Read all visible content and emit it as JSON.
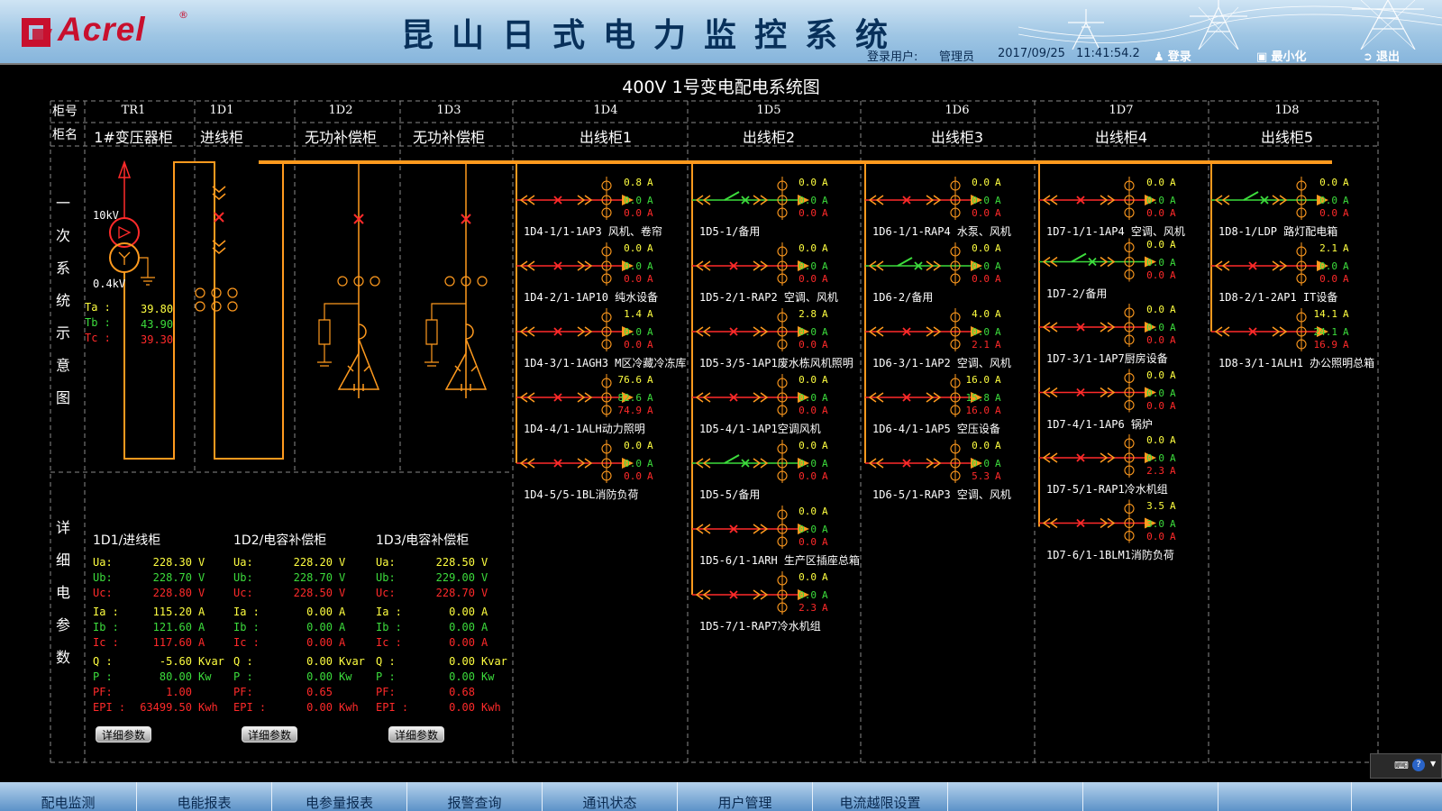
{
  "header": {
    "logo": "Acrel",
    "logo_mark": "®",
    "title": "昆山日式电力监控系统",
    "login_user_label": "登录用户:",
    "user_name": "管理员",
    "date": "2017/09/25",
    "time": "11:41:54.2",
    "login_btn": "登录",
    "minimize_btn": "最小化",
    "exit_btn": "退出"
  },
  "diagram": {
    "title": "400V 1号变电配电系统图",
    "row_cab_no": "柜号",
    "row_cab_name": "柜名",
    "section1": [
      "一",
      "次",
      "系",
      "统",
      "示",
      "意",
      "图"
    ],
    "section2": [
      "详",
      "细",
      "电",
      "参",
      "数"
    ],
    "cabinets": [
      {
        "no": "TR1",
        "name": "1#变压器柜"
      },
      {
        "no": "1D1",
        "name": "进线柜"
      },
      {
        "no": "1D2",
        "name": "无功补偿柜"
      },
      {
        "no": "1D3",
        "name": "无功补偿柜"
      },
      {
        "no": "1D4",
        "name": "出线柜1"
      },
      {
        "no": "1D5",
        "name": "出线柜2"
      },
      {
        "no": "1D6",
        "name": "出线柜3"
      },
      {
        "no": "1D7",
        "name": "出线柜4"
      },
      {
        "no": "1D8",
        "name": "出线柜5"
      }
    ],
    "transformer": {
      "hv": "10kV",
      "lv": "0.4kV",
      "temps": [
        {
          "label": "Ta :",
          "value": "39.80"
        },
        {
          "label": "Tb :",
          "value": "43.90"
        },
        {
          "label": "Tc :",
          "value": "39.30"
        }
      ]
    },
    "unit_a": "A",
    "columns": [
      {
        "id": "1D4",
        "feeders": [
          {
            "name": "1D4-1/1-1AP3 风机、卷帘",
            "ia": "0.8",
            "ib": "0.0",
            "ic": "0.0",
            "state": "closed"
          },
          {
            "name": "1D4-2/1-1AP10 纯水设备",
            "ia": "0.0",
            "ib": "0.0",
            "ic": "0.0",
            "state": "closed"
          },
          {
            "name": "1D4-3/1-1AGH3 M区冷藏冷冻库",
            "ia": "1.4",
            "ib": "0.0",
            "ic": "0.0",
            "state": "closed"
          },
          {
            "name": "1D4-4/1-1ALH动力照明",
            "ia": "76.6",
            "ib": "82.6",
            "ic": "74.9",
            "state": "closed"
          },
          {
            "name": "1D4-5/5-1BL消防负荷",
            "ia": "0.0",
            "ib": "0.0",
            "ic": "0.0",
            "state": "closed"
          }
        ]
      },
      {
        "id": "1D5",
        "feeders": [
          {
            "name": "1D5-1/备用",
            "ia": "0.0",
            "ib": "0.0",
            "ic": "0.0",
            "state": "open"
          },
          {
            "name": "1D5-2/1-RAP2 空调、风机",
            "ia": "0.0",
            "ib": "0.0",
            "ic": "0.0",
            "state": "closed"
          },
          {
            "name": "1D5-3/5-1AP1废水栋风机照明",
            "ia": "2.8",
            "ib": "0.0",
            "ic": "0.0",
            "state": "closed"
          },
          {
            "name": "1D5-4/1-1AP1空调风机",
            "ia": "0.0",
            "ib": "0.0",
            "ic": "0.0",
            "state": "closed"
          },
          {
            "name": "1D5-5/备用",
            "ia": "0.0",
            "ib": "0.0",
            "ic": "0.0",
            "state": "open"
          },
          {
            "name": "1D5-6/1-1ARH 生产区插座总箱",
            "ia": "0.0",
            "ib": "0.0",
            "ic": "0.0",
            "state": "closed"
          },
          {
            "name": "1D5-7/1-RAP7冷水机组",
            "ia": "0.0",
            "ib": "0.0",
            "ic": "2.3",
            "state": "closed"
          }
        ]
      },
      {
        "id": "1D6",
        "feeders": [
          {
            "name": "1D6-1/1-RAP4 水泵、风机",
            "ia": "0.0",
            "ib": "0.0",
            "ic": "0.0",
            "state": "closed"
          },
          {
            "name": "1D6-2/备用",
            "ia": "0.0",
            "ib": "0.0",
            "ic": "0.0",
            "state": "open"
          },
          {
            "name": "1D6-3/1-1AP2 空调、风机",
            "ia": "4.0",
            "ib": "0.0",
            "ic": "2.1",
            "state": "closed"
          },
          {
            "name": "1D6-4/1-1AP5 空压设备",
            "ia": "16.0",
            "ib": "15.8",
            "ic": "16.0",
            "state": "closed"
          },
          {
            "name": "1D6-5/1-RAP3 空调、风机",
            "ia": "0.0",
            "ib": "0.0",
            "ic": "5.3",
            "state": "closed"
          }
        ]
      },
      {
        "id": "1D7",
        "feeders": [
          {
            "name": "1D7-1/1-1AP4 空调、风机",
            "ia": "0.0",
            "ib": "0.0",
            "ic": "0.0",
            "state": "closed"
          },
          {
            "name": "1D7-2/备用",
            "ia": "0.0",
            "ib": "0.0",
            "ic": "0.0",
            "state": "open"
          },
          {
            "name": "1D7-3/1-1AP7厨房设备",
            "ia": "0.0",
            "ib": "0.0",
            "ic": "0.0",
            "state": "closed"
          },
          {
            "name": "1D7-4/1-1AP6 锅炉",
            "ia": "0.0",
            "ib": "0.0",
            "ic": "0.0",
            "state": "closed"
          },
          {
            "name": "1D7-5/1-RAP1冷水机组",
            "ia": "0.0",
            "ib": "0.0",
            "ic": "2.3",
            "state": "closed"
          },
          {
            "name": "1D7-6/1-1BLM1消防负荷",
            "ia": "3.5",
            "ib": "3.0",
            "ic": "0.0",
            "state": "closed"
          }
        ]
      },
      {
        "id": "1D8",
        "feeders": [
          {
            "name": "1D8-1/LDP 路灯配电箱",
            "ia": "0.0",
            "ib": "0.0",
            "ic": "0.0",
            "state": "open"
          },
          {
            "name": "1D8-2/1-2AP1 IT设备",
            "ia": "2.1",
            "ib": "0.0",
            "ic": "0.0",
            "state": "closed"
          },
          {
            "name": "1D8-3/1-1ALH1 办公照明总箱",
            "ia": "14.1",
            "ib": "24.1",
            "ic": "16.9",
            "state": "closed"
          }
        ]
      }
    ],
    "details": [
      {
        "title": "1D1/进线柜",
        "ua": "228.30",
        "ub": "228.70",
        "uc": "228.80",
        "ia": "115.20",
        "ib": "121.60",
        "ic": "117.60",
        "q": "-5.60",
        "p": "80.00",
        "pf": "1.00",
        "epi": "63499.50"
      },
      {
        "title": "1D2/电容补偿柜",
        "ua": "228.20",
        "ub": "228.70",
        "uc": "228.50",
        "ia": "0.00",
        "ib": "0.00",
        "ic": "0.00",
        "q": "0.00",
        "p": "0.00",
        "pf": "0.65",
        "epi": "0.00"
      },
      {
        "title": "1D3/电容补偿柜",
        "ua": "228.50",
        "ub": "229.00",
        "uc": "228.70",
        "ia": "0.00",
        "ib": "0.00",
        "ic": "0.00",
        "q": "0.00",
        "p": "0.00",
        "pf": "0.68",
        "epi": "0.00"
      }
    ],
    "detail_labels": {
      "ua": "Ua:",
      "ub": "Ub:",
      "uc": "Uc:",
      "ia": "Ia :",
      "ib": "Ib :",
      "ic": "Ic :",
      "q": "Q :",
      "p": "P :",
      "pf": "PF:",
      "epi": "EPI :"
    },
    "detail_units": {
      "v": "V",
      "a": "A",
      "q": "Kvar",
      "p": "Kw",
      "epi": "Kwh"
    },
    "detail_btn": "详细参数"
  },
  "nav": [
    "配电监测",
    "电能报表",
    "电参量报表",
    "报警查询",
    "通讯状态",
    "用户管理",
    "电流越限设置",
    "",
    "",
    ""
  ],
  "colors": {
    "orange": "#ff9a1e",
    "red": "#ff2a2a",
    "green": "#3cdc3c",
    "dash": "#8a8a8a"
  },
  "widget": {
    "icons": [
      "keyboard-icon",
      "help-icon"
    ]
  }
}
